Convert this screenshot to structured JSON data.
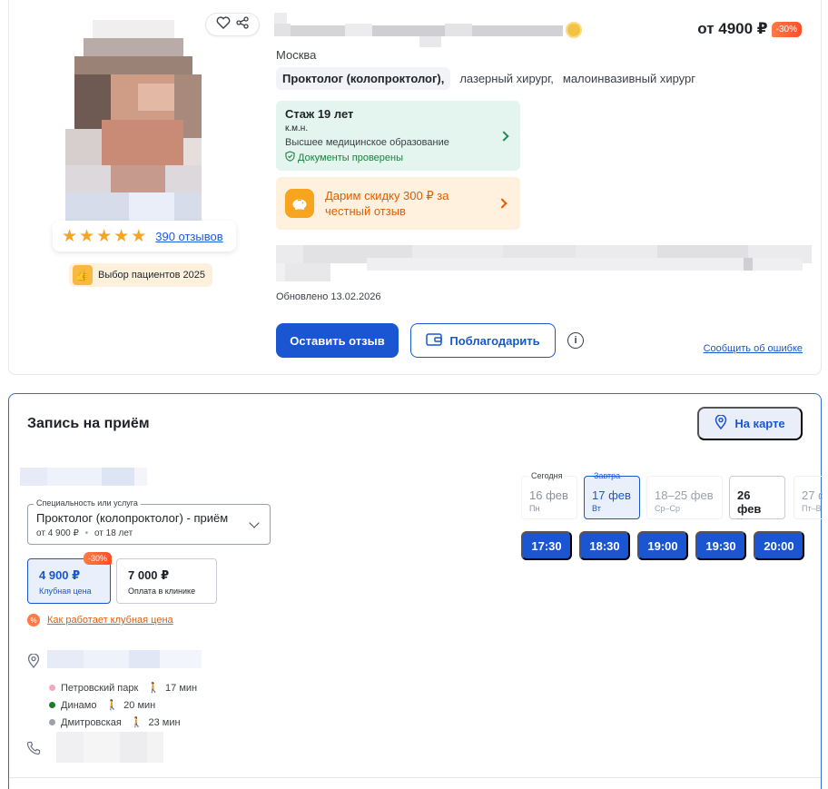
{
  "doctor": {
    "city": "Москва",
    "price": "от 4900 ₽",
    "discount": "-30%",
    "specialties": {
      "main": "Проктолог (колопроктолог),",
      "secondary": [
        "лазерный хирург,",
        "малоинвазивный хирург"
      ]
    },
    "rating": {
      "stars": 5,
      "reviews_link": "390 отзывов"
    },
    "award": "Выбор пациентов 2025",
    "experience": {
      "title": "Стаж 19 лет",
      "degree": "к.м.н.",
      "education": "Высшее медицинское образование",
      "verified": "Документы проверены"
    },
    "promo": "Дарим скидку 300 ₽ за честный отзыв",
    "updated": "Обновлено 13.02.2026",
    "buttons": {
      "review": "Оставить отзыв",
      "thank": "Поблагодарить",
      "info": "i",
      "report": "Сообщить об ошибке"
    }
  },
  "booking": {
    "title": "Запись на приём",
    "map_button": "На карте",
    "service_select": {
      "legend": "Специальность или услуга",
      "value": "Проктолог (колопроктолог) - приём",
      "price": "от 4 900 ₽",
      "separator": "•",
      "age": "от 18 лет"
    },
    "price_options": [
      {
        "value": "4 900 ₽",
        "label": "Клубная цена",
        "badge": "-30%"
      },
      {
        "value": "7 000 ₽",
        "label": "Оплата в клинике"
      }
    ],
    "club_link": "Как работает клубная цена",
    "club_icon": "%",
    "metro": [
      {
        "name": "Петровский парк",
        "time": "17 мин",
        "color": "#f2a9b9"
      },
      {
        "name": "Динамо",
        "time": "20 мин",
        "color": "#1d7a2e"
      },
      {
        "name": "Дмитровская",
        "time": "23 мин",
        "color": "#9aa1ab"
      }
    ],
    "dates": [
      {
        "top": "Сегодня",
        "day": "16 фев",
        "weekday": "Пн"
      },
      {
        "top": "Завтра",
        "day": "17 фев",
        "weekday": "Вт"
      },
      {
        "top": "",
        "day": "18–25 фев",
        "weekday": "Ср–Ср"
      },
      {
        "top": "",
        "day": "26 фев",
        "weekday": "Чт"
      },
      {
        "top": "",
        "day": "27 ф",
        "weekday": "Пт–В"
      }
    ],
    "slots": [
      "17:30",
      "18:30",
      "19:00",
      "19:30",
      "20:00"
    ]
  },
  "colors": {
    "accent": "#1a56d2",
    "orange": "#e35d00",
    "green": "#17813f",
    "star": "#f5a524"
  }
}
